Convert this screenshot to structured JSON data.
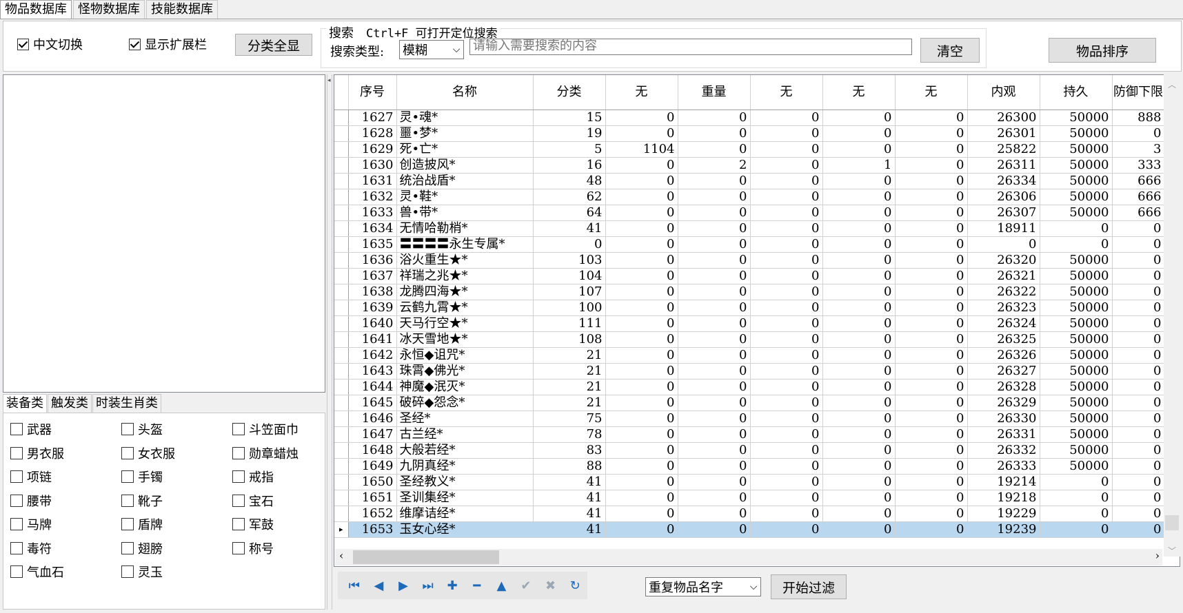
{
  "tabs": [
    "物品数据库",
    "怪物数据库",
    "技能数据库"
  ],
  "toolbar": {
    "cn_toggle": "中文切换",
    "show_ext": "显示扩展栏",
    "show_all_btn": "分类全显",
    "search_title": "搜索",
    "search_hint": "Ctrl+F 可打开定位搜索",
    "search_type_label": "搜索类型:",
    "search_type_value": "模糊",
    "search_placeholder": "请输入需要搜索的内容",
    "clear_btn": "清空",
    "sort_btn": "物品排序"
  },
  "subtabs": [
    "装备类",
    "触发类",
    "时装生肖类"
  ],
  "categories": [
    [
      "武器",
      "头盔",
      "斗笠面巾"
    ],
    [
      "男衣服",
      "女衣服",
      "勋章蜡烛"
    ],
    [
      "项链",
      "手镯",
      "戒指"
    ],
    [
      "腰带",
      "靴子",
      "宝石"
    ],
    [
      "马牌",
      "盾牌",
      "军鼓"
    ],
    [
      "毒符",
      "翅膀",
      "称号"
    ],
    [
      "气血石",
      "灵玉"
    ]
  ],
  "columns": [
    "序号",
    "名称",
    "分类",
    "无",
    "重量",
    "无",
    "无",
    "无",
    "内观",
    "持久",
    "防御下限"
  ],
  "rows": [
    [
      "1627",
      "灵•魂*",
      "15",
      "0",
      "0",
      "0",
      "0",
      "0",
      "26300",
      "50000",
      "888"
    ],
    [
      "1628",
      "噩•梦*",
      "19",
      "0",
      "0",
      "0",
      "0",
      "0",
      "26301",
      "50000",
      "0"
    ],
    [
      "1629",
      "死•亡*",
      "5",
      "1104",
      "0",
      "0",
      "0",
      "0",
      "25822",
      "50000",
      "3"
    ],
    [
      "1630",
      "创造披风*",
      "16",
      "0",
      "2",
      "0",
      "1",
      "0",
      "26311",
      "50000",
      "333"
    ],
    [
      "1631",
      "统治战盾*",
      "48",
      "0",
      "0",
      "0",
      "0",
      "0",
      "26334",
      "50000",
      "666"
    ],
    [
      "1632",
      "灵•鞋*",
      "62",
      "0",
      "0",
      "0",
      "0",
      "0",
      "26306",
      "50000",
      "666"
    ],
    [
      "1633",
      "兽•带*",
      "64",
      "0",
      "0",
      "0",
      "0",
      "0",
      "26307",
      "50000",
      "666"
    ],
    [
      "1634",
      "无情哈勒梢*",
      "41",
      "0",
      "0",
      "0",
      "0",
      "0",
      "18911",
      "0",
      "0"
    ],
    [
      "1635",
      "〓〓〓〓永生专属*",
      "0",
      "0",
      "0",
      "0",
      "0",
      "0",
      "0",
      "0",
      "0"
    ],
    [
      "1636",
      "浴火重生★*",
      "103",
      "0",
      "0",
      "0",
      "0",
      "0",
      "26320",
      "50000",
      "0"
    ],
    [
      "1637",
      "祥瑞之兆★*",
      "104",
      "0",
      "0",
      "0",
      "0",
      "0",
      "26321",
      "50000",
      "0"
    ],
    [
      "1638",
      "龙腾四海★*",
      "107",
      "0",
      "0",
      "0",
      "0",
      "0",
      "26322",
      "50000",
      "0"
    ],
    [
      "1639",
      "云鹤九霄★*",
      "100",
      "0",
      "0",
      "0",
      "0",
      "0",
      "26323",
      "50000",
      "0"
    ],
    [
      "1640",
      "天马行空★*",
      "111",
      "0",
      "0",
      "0",
      "0",
      "0",
      "26324",
      "50000",
      "0"
    ],
    [
      "1641",
      "冰天雪地★*",
      "108",
      "0",
      "0",
      "0",
      "0",
      "0",
      "26325",
      "50000",
      "0"
    ],
    [
      "1642",
      "永恒◆诅咒*",
      "21",
      "0",
      "0",
      "0",
      "0",
      "0",
      "26326",
      "50000",
      "0"
    ],
    [
      "1643",
      "珠霄◆佛光*",
      "21",
      "0",
      "0",
      "0",
      "0",
      "0",
      "26327",
      "50000",
      "0"
    ],
    [
      "1644",
      "神魔◆泯灭*",
      "21",
      "0",
      "0",
      "0",
      "0",
      "0",
      "26328",
      "50000",
      "0"
    ],
    [
      "1645",
      "破碎◆怨念*",
      "21",
      "0",
      "0",
      "0",
      "0",
      "0",
      "26329",
      "50000",
      "0"
    ],
    [
      "1646",
      "圣经*",
      "75",
      "0",
      "0",
      "0",
      "0",
      "0",
      "26330",
      "50000",
      "0"
    ],
    [
      "1647",
      "古兰经*",
      "78",
      "0",
      "0",
      "0",
      "0",
      "0",
      "26331",
      "50000",
      "0"
    ],
    [
      "1648",
      "大般若经*",
      "83",
      "0",
      "0",
      "0",
      "0",
      "0",
      "26332",
      "50000",
      "0"
    ],
    [
      "1649",
      "九阴真经*",
      "88",
      "0",
      "0",
      "0",
      "0",
      "0",
      "26333",
      "50000",
      "0"
    ],
    [
      "1650",
      "圣经教义*",
      "41",
      "0",
      "0",
      "0",
      "0",
      "0",
      "19214",
      "0",
      "0"
    ],
    [
      "1651",
      "圣训集经*",
      "41",
      "0",
      "0",
      "0",
      "0",
      "0",
      "19218",
      "0",
      "0"
    ],
    [
      "1652",
      "维摩诘经*",
      "41",
      "0",
      "0",
      "0",
      "0",
      "0",
      "19229",
      "0",
      "0"
    ],
    [
      "1653",
      "玉女心经*",
      "41",
      "0",
      "0",
      "0",
      "0",
      "0",
      "19239",
      "0",
      "0"
    ]
  ],
  "selected_row_index": 26,
  "nav_icons": [
    "first-icon",
    "prev-icon",
    "next-icon",
    "last-icon",
    "add-icon",
    "delete-icon",
    "edit-icon",
    "post-icon",
    "cancel-icon",
    "refresh-icon"
  ],
  "filter": {
    "type_value": "重复物品名字",
    "start_btn": "开始过滤"
  }
}
